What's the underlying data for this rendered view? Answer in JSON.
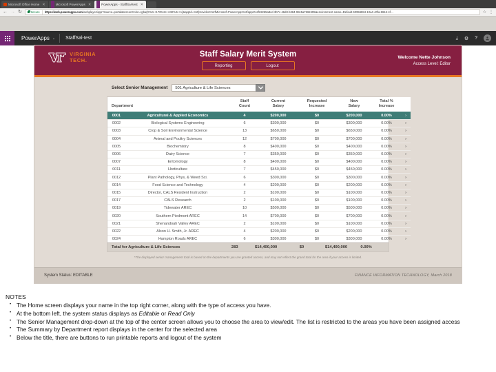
{
  "browser": {
    "tabs": [
      {
        "title": "Microsoft Office Home",
        "favicon": "office-icon",
        "active": false
      },
      {
        "title": "Microsoft PowerApps",
        "favicon": "powerapps-icon",
        "active": false
      },
      {
        "title": "PowerApps - StaffSal-test",
        "favicon": "powerapps-icon",
        "active": true
      }
    ],
    "nav": {
      "back": "←",
      "forward": "→",
      "reload": "↻"
    },
    "security_label": "Secure",
    "url_domain": "https://web.powerapps.com",
    "url_path": "/webplayer/app?source=portal&screenColor=rgba(0%2c+178%2c+240%2c+1)&appId=%2fproviders%2fMicrosoft.PowerApps%2fapps%2f22265a8cd-3b7c-46d3-b384-98c5a7662495&environment-name=Default-60956884-10a4-40fa-8616-4f…",
    "bookmark_icon": "star-icon",
    "menu_icon": "kebab-menu-icon"
  },
  "powerapps_bar": {
    "waffle_icon": "app-launcher-icon",
    "brand": "PowerApps",
    "brand_caret": "⌄",
    "app_name": "StaffSal-test",
    "right_icons": [
      "download-icon",
      "gear-icon",
      "help-icon",
      "account-avatar"
    ],
    "download_glyph": "⤓",
    "gear_glyph": "⚙",
    "help_glyph": "?",
    "avatar_glyph": "●"
  },
  "app": {
    "logo": {
      "mark": "VT",
      "line1": "VIRGINIA",
      "line2": "TECH."
    },
    "title": "Staff Salary Merit System",
    "buttons": [
      {
        "label": "Reporting",
        "name": "reporting-button"
      },
      {
        "label": "Logout",
        "name": "logout-button"
      }
    ],
    "welcome": "Welcome Nette Johnson",
    "access_level": "Access Level: Editor",
    "selector": {
      "label": "Select Senior Management",
      "value": "501 Agriculture & Life Sciences",
      "caret": "⌄"
    },
    "table": {
      "headers": [
        "Department",
        "Staff\nCount",
        "Current\nSalary",
        "Requested\nIncrease",
        "New\nSalary",
        "Total %\nIncrease"
      ],
      "header_department": "Department",
      "header_staff_count_l1": "Staff",
      "header_staff_count_l2": "Count",
      "header_current_l1": "Current",
      "header_current_l2": "Salary",
      "header_requested_l1": "Requested",
      "header_requested_l2": "Increase",
      "header_new_l1": "New",
      "header_new_l2": "Salary",
      "header_total_l1": "Total %",
      "header_total_l2": "Increase",
      "chevron": "›",
      "rows": [
        {
          "code": "0001",
          "name": "Agricultural & Applied Economics",
          "staff": "4",
          "current": "$200,000",
          "requested": "$0",
          "new": "$200,000",
          "pct": "0.00%",
          "selected": true
        },
        {
          "code": "0002",
          "name": "Biological Systems Engineering",
          "staff": "6",
          "current": "$300,000",
          "requested": "$0",
          "new": "$300,000",
          "pct": "0.00%",
          "selected": false
        },
        {
          "code": "0003",
          "name": "Crop & Soil Environmental Science",
          "staff": "13",
          "current": "$650,000",
          "requested": "$0",
          "new": "$650,000",
          "pct": "0.00%",
          "selected": false
        },
        {
          "code": "0004",
          "name": "Animal and Poultry Sciences",
          "staff": "12",
          "current": "$700,000",
          "requested": "$0",
          "new": "$700,000",
          "pct": "0.00%",
          "selected": false
        },
        {
          "code": "0005",
          "name": "Biochemistry",
          "staff": "8",
          "current": "$400,000",
          "requested": "$0",
          "new": "$400,000",
          "pct": "0.00%",
          "selected": false
        },
        {
          "code": "0006",
          "name": "Dairy Science",
          "staff": "7",
          "current": "$350,000",
          "requested": "$0",
          "new": "$350,000",
          "pct": "0.00%",
          "selected": false
        },
        {
          "code": "0007",
          "name": "Entomology",
          "staff": "8",
          "current": "$400,000",
          "requested": "$0",
          "new": "$400,000",
          "pct": "0.00%",
          "selected": false
        },
        {
          "code": "0011",
          "name": "Horticulture",
          "staff": "7",
          "current": "$450,000",
          "requested": "$0",
          "new": "$450,000",
          "pct": "0.00%",
          "selected": false
        },
        {
          "code": "0012",
          "name": "Plant Pathology, Phys, & Weed Sci.",
          "staff": "6",
          "current": "$300,000",
          "requested": "$0",
          "new": "$300,000",
          "pct": "0.00%",
          "selected": false
        },
        {
          "code": "0014",
          "name": "Food Science and Technology",
          "staff": "4",
          "current": "$200,000",
          "requested": "$0",
          "new": "$200,000",
          "pct": "0.00%",
          "selected": false
        },
        {
          "code": "0015",
          "name": "Director, CALS Resident Instruction",
          "staff": "2",
          "current": "$100,000",
          "requested": "$0",
          "new": "$100,000",
          "pct": "0.00%",
          "selected": false
        },
        {
          "code": "0017",
          "name": "CALS Research",
          "staff": "2",
          "current": "$100,000",
          "requested": "$0",
          "new": "$100,000",
          "pct": "0.00%",
          "selected": false
        },
        {
          "code": "0019",
          "name": "Tidewater AREC",
          "staff": "10",
          "current": "$500,000",
          "requested": "$0",
          "new": "$500,000",
          "pct": "0.00%",
          "selected": false
        },
        {
          "code": "0020",
          "name": "Southern Piedmont AREC",
          "staff": "14",
          "current": "$700,000",
          "requested": "$0",
          "new": "$700,000",
          "pct": "0.00%",
          "selected": false
        },
        {
          "code": "0021",
          "name": "Shenandoah Valley AREC",
          "staff": "2",
          "current": "$100,000",
          "requested": "$0",
          "new": "$100,000",
          "pct": "0.00%",
          "selected": false
        },
        {
          "code": "0022",
          "name": "Alson H. Smith, Jr. AREC",
          "staff": "4",
          "current": "$200,000",
          "requested": "$0",
          "new": "$200,000",
          "pct": "0.00%",
          "selected": false
        },
        {
          "code": "0024",
          "name": "Hampton Roads AREC",
          "staff": "6",
          "current": "$300,000",
          "requested": "$0",
          "new": "$300,000",
          "pct": "0.00%",
          "selected": false
        }
      ],
      "total": {
        "label": "Total for Agriculture & Life Sciences",
        "staff": "283",
        "current": "$14,400,000",
        "requested": "$0",
        "new": "$14,400,000",
        "pct": "0.00%"
      },
      "footnote": "*The displayed senior management total is based on the departments you are granted access, and may not reflect the grand total for the area if your access is limited."
    },
    "status_bar": {
      "system_status": "System Status: EDITABLE",
      "credit": "FINANCE INFORMATION TECHNOLOGY, March 2018"
    }
  },
  "notes": {
    "heading": "NOTES",
    "items": [
      "The Home screen displays your name in the top right corner, along with the type of access you have.",
      "At the bottom left, the system status displays as Editable or Read Only",
      "The Senior Management drop-down at the top of the center screen allows you to choose the area to view/edit.  The list is restricted to the areas you have been assigned access",
      "The Summary by Department report displays in the center for the selected area",
      "Below the title, there are buttons to run printable reports and logout of the system"
    ],
    "italic_terms": [
      "Editable",
      "Read Only"
    ]
  },
  "colors": {
    "vt_maroon": "#861f41",
    "vt_orange": "#e87722",
    "selected_row": "#3f7d77",
    "app_background": "#e2dbd4",
    "status_bar": "#cfc7bf",
    "powerapps_purple": "#742774"
  }
}
